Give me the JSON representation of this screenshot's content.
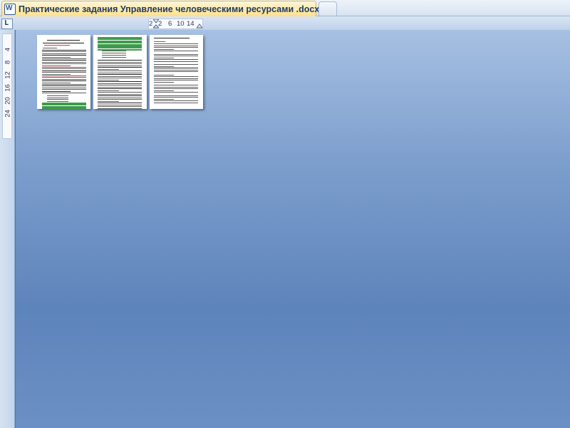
{
  "tab": {
    "title": "Практические  задания Управление человеческими ресурсами .docx *",
    "close_glyph": "×",
    "app_icon_letter": "W"
  },
  "ruler": {
    "tab_selector_glyph": "L",
    "horizontal_numbers": [
      "2",
      "2",
      "6",
      "10",
      "14"
    ],
    "vertical_numbers": [
      "4",
      "8",
      "12",
      "16",
      "20",
      "24"
    ]
  },
  "pages": [
    {
      "name": "page-1"
    },
    {
      "name": "page-2"
    },
    {
      "name": "page-3"
    }
  ],
  "colors": {
    "canvas_top": "#a6c0e2",
    "canvas_bottom": "#5d84bb",
    "tab_active": "#ffe08a",
    "highlight_green": "#3f9b4c",
    "highlight_red": "#c43a3a"
  }
}
